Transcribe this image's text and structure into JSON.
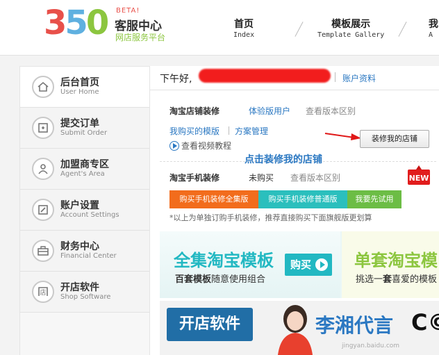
{
  "header": {
    "logo": {
      "number_parts": [
        "3",
        "5",
        "0"
      ],
      "beta": "BETA!",
      "title": "客服中心",
      "subtitle": "网店服务平台"
    },
    "nav": [
      {
        "label": "首页",
        "sub": "Index"
      },
      {
        "label": "模板展示",
        "sub": "Template Gallery"
      },
      {
        "label": "我",
        "sub": "A"
      }
    ]
  },
  "sidebar": {
    "items": [
      {
        "label": "后台首页",
        "sub": "User Home",
        "icon": "home-icon"
      },
      {
        "label": "提交订单",
        "sub": "Submit Order",
        "icon": "order-icon"
      },
      {
        "label": "加盟商专区",
        "sub": "Agent's Area",
        "icon": "agent-icon"
      },
      {
        "label": "账户设置",
        "sub": "Account Settings",
        "icon": "edit-icon"
      },
      {
        "label": "财务中心",
        "sub": "Financial Center",
        "icon": "briefcase-icon"
      },
      {
        "label": "开店软件",
        "sub": "Shop Software",
        "icon": "store-icon"
      }
    ]
  },
  "main": {
    "greeting": "下午好,",
    "account_link": "账户资料",
    "taobao_store": {
      "title": "淘宝店铺装修",
      "status": "体验版用户",
      "compare": "查看版本区别",
      "my_templates": "我购买的模版",
      "manage": "方案管理",
      "video": "查看视频教程",
      "decorate_button": "装修我的店铺"
    },
    "annotation": "点击装修我的店铺",
    "taobao_mobile": {
      "title": "淘宝手机装修",
      "status": "未购买",
      "compare": "查看版本区别",
      "badge": "NEW",
      "buttons": [
        "购买手机装修全集版",
        "购买手机装修普通版",
        "我要先试用"
      ],
      "note": "*以上为单独订购手机装修，推荐直接购买下面旗舰版更划算"
    },
    "banner1": {
      "title": "全集淘宝模板",
      "sub_bold": "百套模板",
      "sub_rest": "随意使用组合",
      "buy": "购买",
      "title2": "单套淘宝模",
      "sub2_pre": "挑选一",
      "sub2_bold": "套",
      "sub2_rest": "喜爱的模板"
    },
    "banner2": {
      "store_button": "开店软件",
      "name": "李湘代言",
      "co": "C©"
    },
    "watermark": "jingyan.baidu.com"
  },
  "colors": {
    "accent_blue": "#2b78c2",
    "logo_red": "#e8504a",
    "logo_blue": "#5fb0e0",
    "logo_green": "#8cc63f",
    "teal": "#22b8c2",
    "orange": "#f26c1c"
  }
}
